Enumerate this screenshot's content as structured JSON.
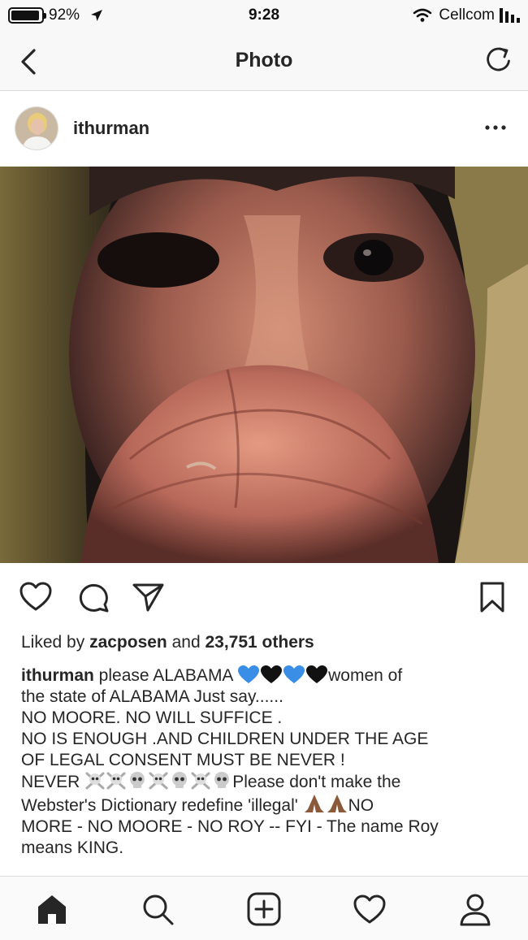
{
  "status_bar": {
    "battery": "92%",
    "time": "9:28",
    "carrier": "Cellcom"
  },
  "nav": {
    "title": "Photo"
  },
  "post": {
    "username": "ithurman",
    "likes_prefix": "Liked by ",
    "likes_user": "zacposen",
    "likes_middle": " and ",
    "likes_count": "23,751 others",
    "caption": {
      "user": "ithurman",
      "line1_text": " please ALABAMA ",
      "line1_after": "women of",
      "line2": "the state of ALABAMA Just say......",
      "line3": "NO MOORE. NO WILL SUFFICE .",
      "line4": "NO IS ENOUGH .AND CHILDREN UNDER THE AGE",
      "line5": "OF LEGAL CONSENT MUST BE NEVER !",
      "line6_before": "NEVER ",
      "line6_after": "Please don't make the",
      "line7_before": "Webster's Dictionary redefine 'illegal' ",
      "line7_after": "NO",
      "line8": "MORE - NO MOORE - NO ROY -- FYI - The name Roy",
      "line9": "means KING."
    }
  },
  "icons": {
    "back": "chevron-left-icon",
    "refresh": "refresh-icon",
    "more": "more-dots-icon",
    "like": "heart-icon",
    "comment": "comment-icon",
    "share": "send-icon",
    "save": "bookmark-icon",
    "home": "home-icon",
    "search": "search-icon",
    "add": "add-post-icon",
    "activity": "activity-heart-icon",
    "profile": "profile-icon"
  },
  "colors": {
    "heart_blue": "#3a8ee6",
    "heart_black": "#111111",
    "text": "#262626",
    "bar_bg": "#f8f8f8"
  }
}
